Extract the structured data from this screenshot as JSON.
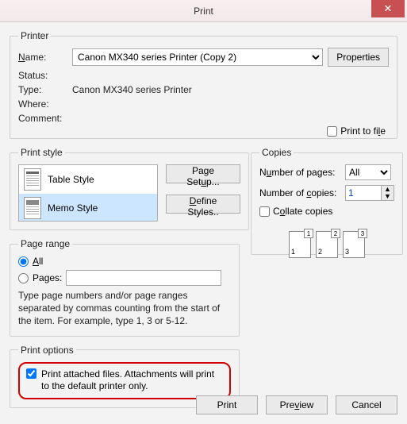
{
  "window": {
    "title": "Print",
    "close": "✕"
  },
  "printer": {
    "legend": "Printer",
    "name_label": "Name:",
    "name_value": "Canon MX340 series Printer (Copy 2)",
    "properties_btn": "Properties",
    "status_label": "Status:",
    "status_value": "",
    "type_label": "Type:",
    "type_value": "Canon MX340 series Printer",
    "where_label": "Where:",
    "where_value": "",
    "comment_label": "Comment:",
    "comment_value": "",
    "print_to_file": "Print to file"
  },
  "print_style": {
    "legend": "Print style",
    "items": [
      {
        "label": "Table Style"
      },
      {
        "label": "Memo Style"
      }
    ],
    "page_setup_btn": "Page Setup...",
    "define_styles_btn": "Define Styles.."
  },
  "copies": {
    "legend": "Copies",
    "num_pages_label": "Number of pages:",
    "num_pages_value": "All",
    "num_copies_label": "Number of copies:",
    "num_copies_value": "1",
    "collate_label": "Collate copies",
    "page_nums": [
      "1",
      "2",
      "3"
    ],
    "page_sup": [
      "1",
      "2",
      "3"
    ]
  },
  "page_range": {
    "legend": "Page range",
    "all_label": "All",
    "pages_label": "Pages:",
    "pages_value": "",
    "hint": "Type page numbers and/or page ranges separated by commas counting from the start of the item.  For example, type 1, 3 or 5-12."
  },
  "print_options": {
    "legend": "Print options",
    "attach_label": "Print attached files.  Attachments will print to the default printer only."
  },
  "footer": {
    "print": "Print",
    "preview": "Preview",
    "cancel": "Cancel"
  }
}
